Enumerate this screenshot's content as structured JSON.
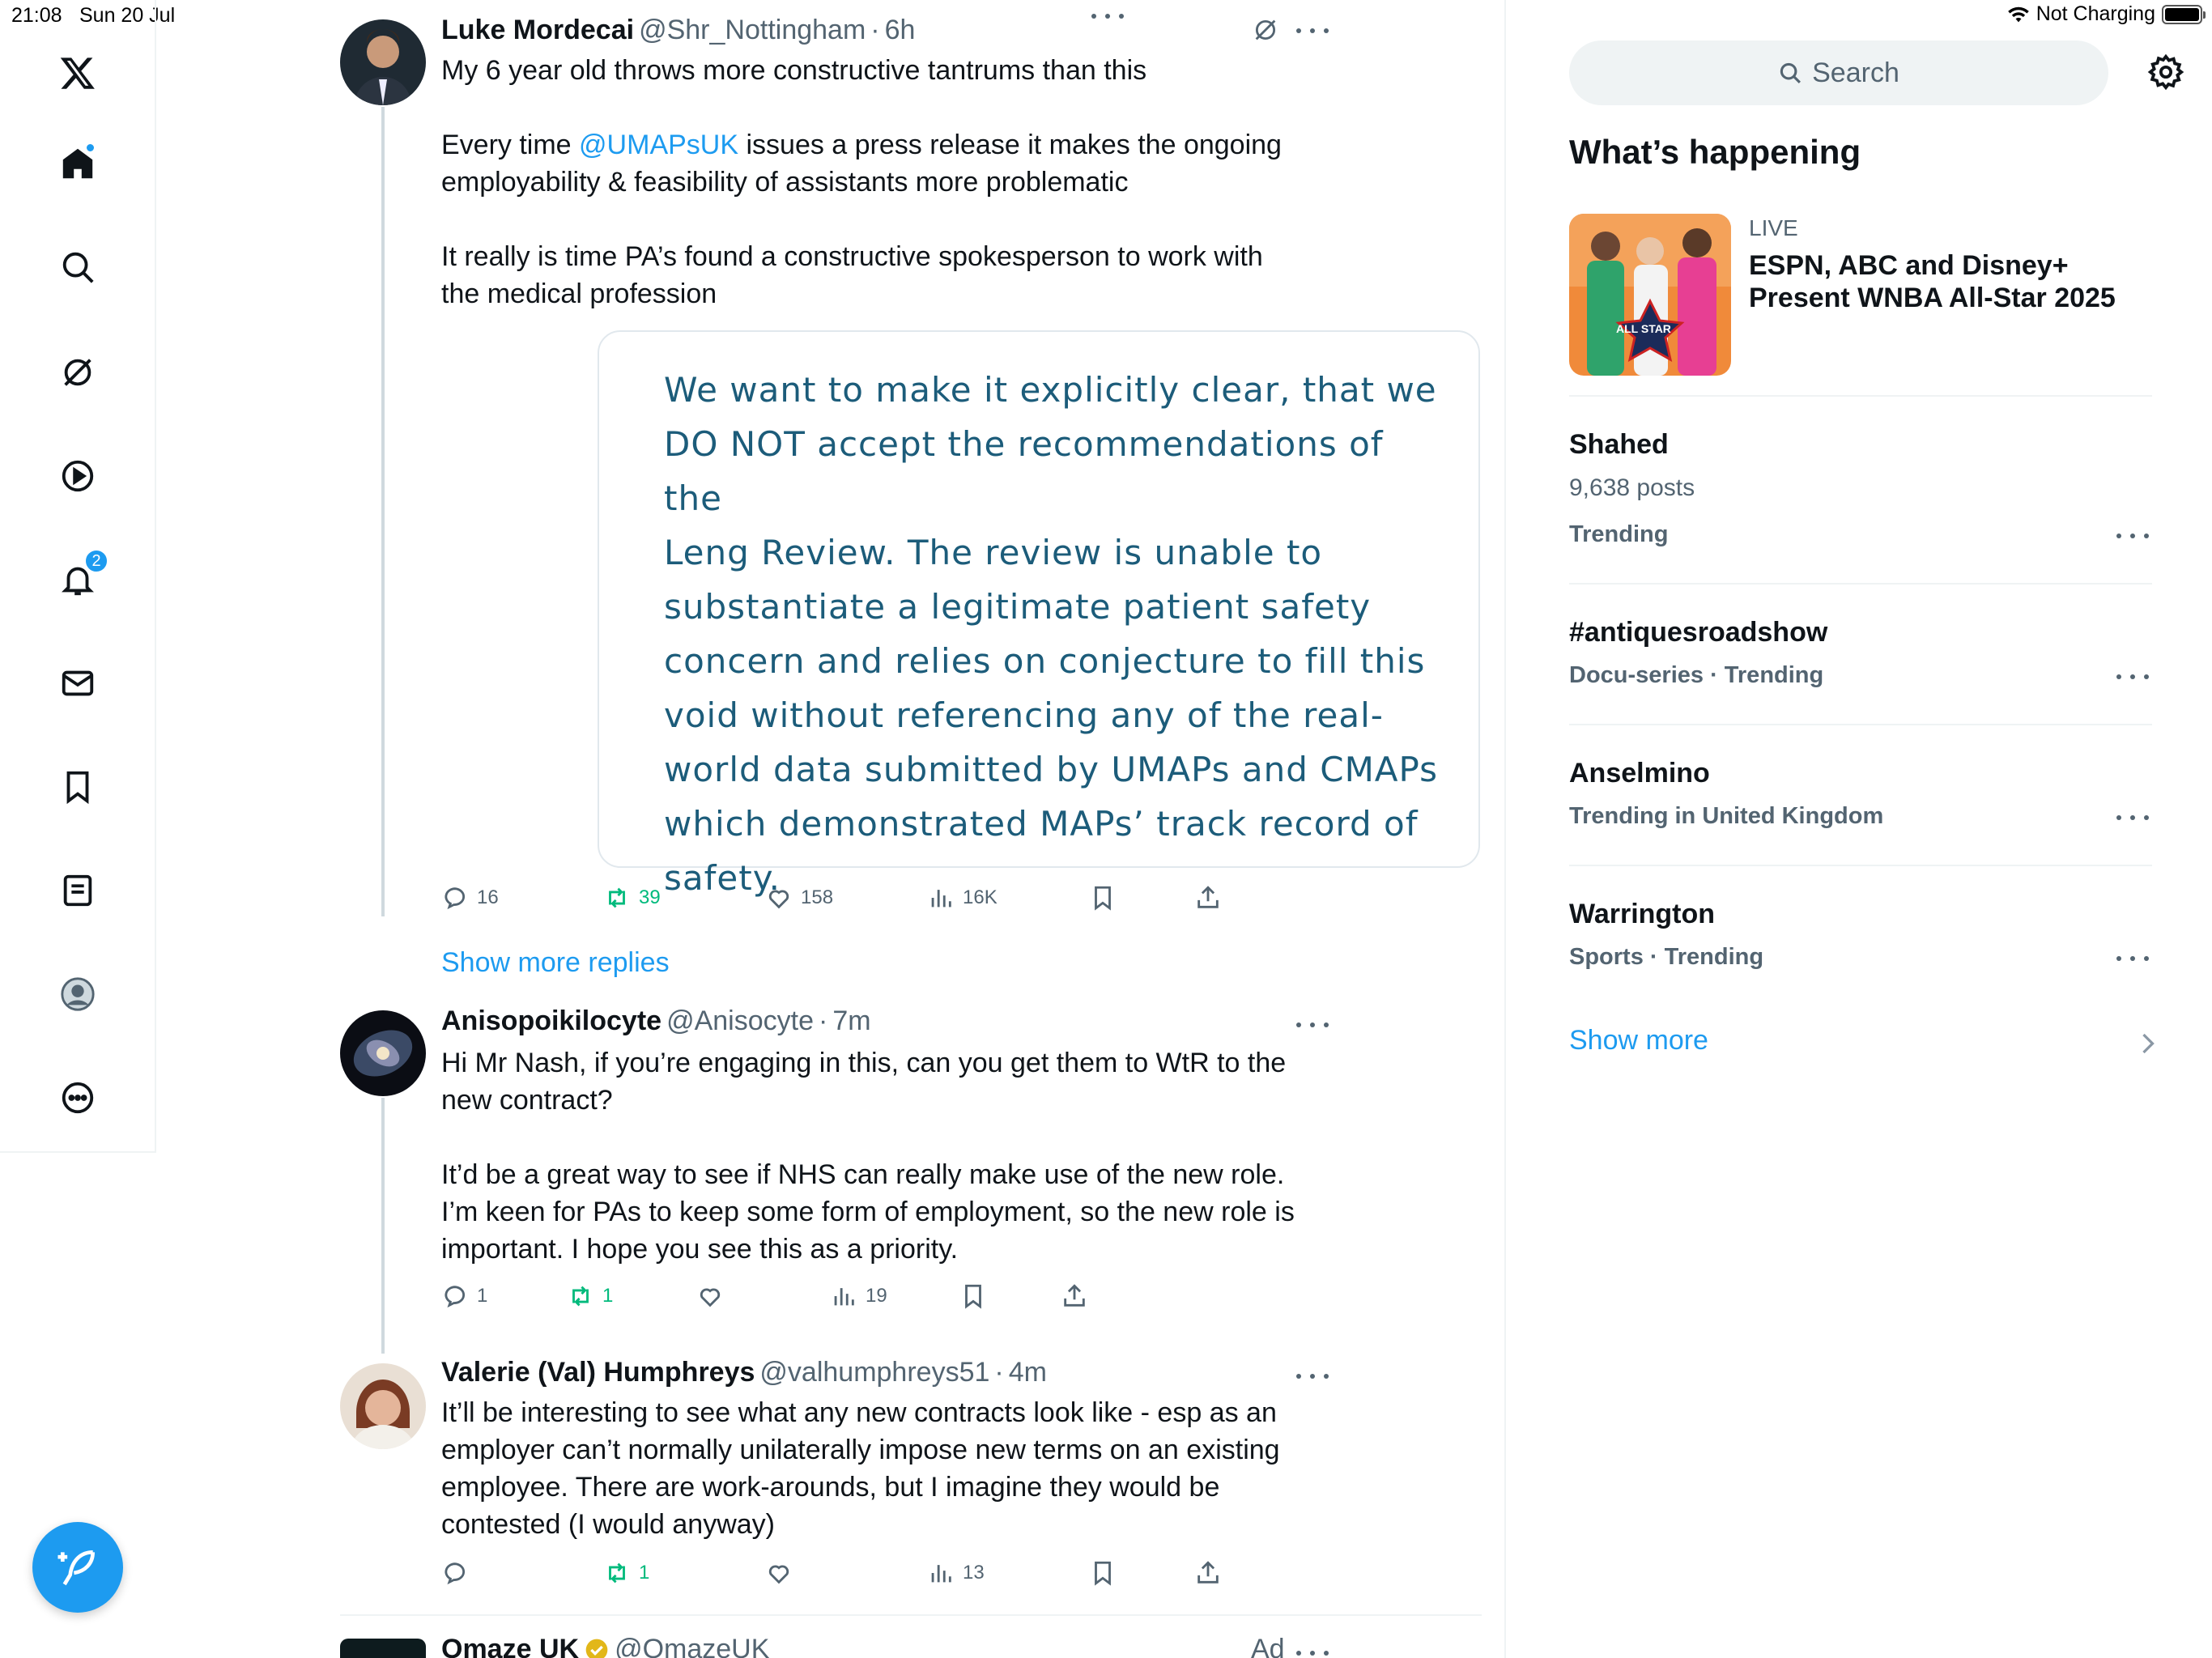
{
  "status_bar": {
    "time": "21:08",
    "date": "Sun 20 Jul",
    "battery_text": "Not Charging"
  },
  "nav": {
    "notifications_badge": "2"
  },
  "tweets": [
    {
      "name": "Luke Mordecai",
      "handle": "@Shr_Nottingham",
      "time": "6h",
      "text_1": "My 6 year old throws more constructive tantrums than this",
      "mention": "@UMAPsUK",
      "text_2_pre": "Every time ",
      "text_2_post": " issues a press release it makes the ongoing\nemployability & feasibility of assistants more problematic",
      "text_3": "It really is time PA’s found a constructive spokesperson to work with\nthe medical profession",
      "quote": "We want to make it explicitly clear, that we\nDO NOT accept the recommendations of the\nLeng Review. The review is unable to\nsubstantiate a legitimate patient safety\nconcern and relies on conjecture to fill this\nvoid without referencing any of the real-\nworld data submitted by UMAPs and CMAPs\nwhich demonstrated MAPs’ track record of\nsafety.",
      "replies": "16",
      "reposts": "39",
      "likes": "158",
      "views": "16K"
    },
    {
      "name": "Anisopoikilocyte",
      "handle": "@Anisocyte",
      "time": "7m",
      "text_1": "Hi Mr Nash, if you’re engaging in this, can you get them to WtR to the\nnew contract?",
      "text_2": "It’d be a great way to see if NHS can really make use of the new role.\nI’m keen for PAs to keep some form of employment, so the new role is\nimportant. I hope you see this as a priority.",
      "replies": "1",
      "reposts": "1",
      "likes": "",
      "views": "19"
    },
    {
      "name": "Valerie (Val) Humphreys",
      "handle": "@valhumphreys51",
      "time": "4m",
      "text_1": "It’ll be interesting to see what any new contracts look like - esp as an\nemployer can’t normally unilaterally impose new terms on an existing\nemployee. There are work-arounds, but I imagine they would be\ncontested (I would anyway)",
      "replies": "",
      "reposts": "1",
      "likes": "",
      "views": "13"
    },
    {
      "name": "Omaze UK",
      "handle": "@OmazeUK",
      "ad_label": "Ad"
    }
  ],
  "show_more_replies": "Show more replies",
  "sidebar": {
    "search_placeholder": "Search",
    "title": "What’s happening",
    "live": {
      "label": "LIVE",
      "title": "ESPN, ABC and Disney+\nPresent WNBA All-Star 2025",
      "image_text": "ALL STAR"
    },
    "trends": [
      {
        "name": "Shahed",
        "sub": "9,638 posts",
        "meta": "Trending"
      },
      {
        "name": "#antiquesroadshow",
        "meta": "Docu-series · Trending"
      },
      {
        "name": "Anselmino",
        "meta": "Trending in United Kingdom"
      },
      {
        "name": "Warrington",
        "meta": "Sports · Trending"
      }
    ],
    "show_more": "Show more"
  },
  "colors": {
    "accent": "#1d9bf0",
    "repost": "#00ba7c",
    "secondary_text": "#536471",
    "quote_text": "#1c5c7a"
  }
}
